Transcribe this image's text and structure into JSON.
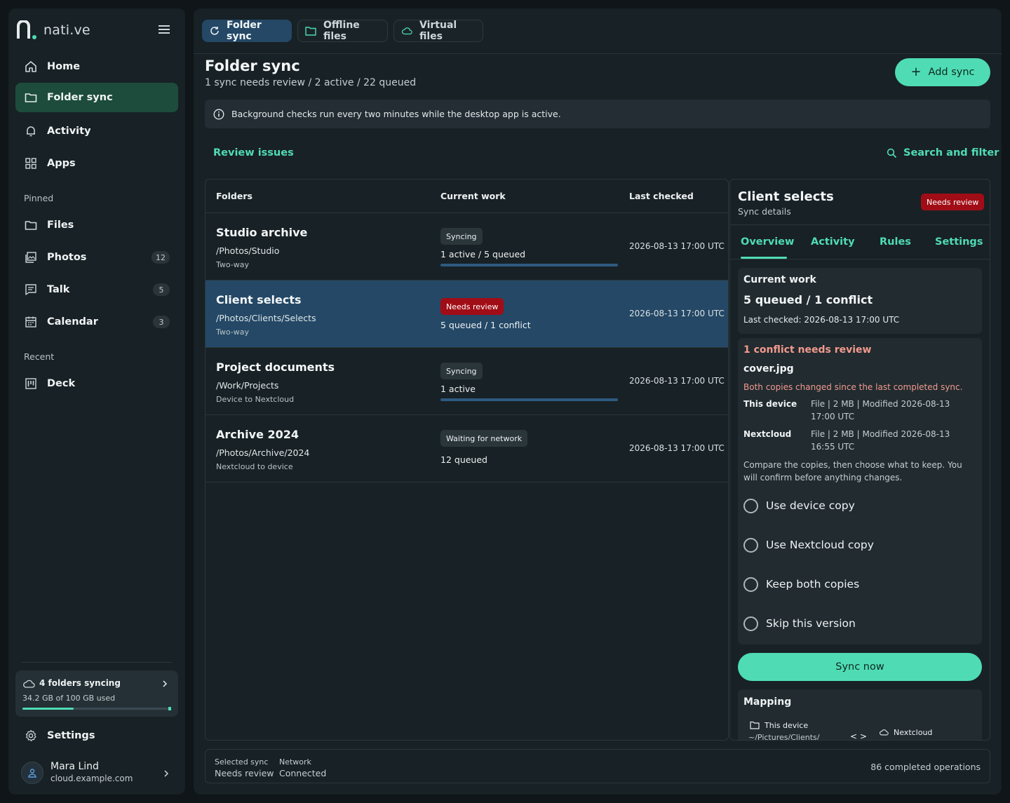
{
  "brand": {
    "name": "nati.ve"
  },
  "sidebar": {
    "nav": [
      {
        "label": "Home",
        "icon": "home-icon"
      },
      {
        "label": "Folder sync",
        "icon": "folder-icon",
        "active": true
      },
      {
        "label": "Activity",
        "icon": "bell-icon"
      },
      {
        "label": "Apps",
        "icon": "apps-grid-icon"
      }
    ],
    "pinned_label": "Pinned",
    "pinned": [
      {
        "label": "Files",
        "icon": "folder-icon"
      },
      {
        "label": "Photos",
        "icon": "photos-icon",
        "badge": "12"
      },
      {
        "label": "Talk",
        "icon": "chat-icon",
        "badge": "5"
      },
      {
        "label": "Calendar",
        "icon": "calendar-icon",
        "badge": "3"
      }
    ],
    "recent_label": "Recent",
    "recent": [
      {
        "label": "Deck",
        "icon": "deck-icon"
      }
    ],
    "storage": {
      "title": "4 folders syncing",
      "used": "34.2 GB of 100 GB used",
      "used_fraction": 0.342
    },
    "settings_label": "Settings",
    "user": {
      "name": "Mara Lind",
      "host": "cloud.example.com"
    }
  },
  "tabs": [
    {
      "label": "Folder sync",
      "icon": "refresh-icon",
      "active": true
    },
    {
      "label": "Offline files",
      "icon": "folder-icon"
    },
    {
      "label": "Virtual files",
      "icon": "cloud-icon"
    }
  ],
  "page": {
    "title": "Folder sync",
    "subtitle": "1 sync needs review / 2 active / 22 queued",
    "add_label": "Add sync",
    "info": "Background checks run every two minutes while the desktop app is active.",
    "review_link": "Review issues",
    "search_link": "Search and filter"
  },
  "table": {
    "headers": {
      "folders": "Folders",
      "work": "Current work",
      "checked": "Last checked"
    },
    "rows": [
      {
        "name": "Studio archive",
        "path": "/Photos/Studio",
        "mode": "Two-way",
        "status": "Syncing",
        "work": "1 active / 5 queued",
        "progress": 1.0,
        "checked": "2026-08-13 17:00 UTC"
      },
      {
        "name": "Client selects",
        "path": "/Photos/Clients/Selects",
        "mode": "Two-way",
        "status": "Needs review",
        "work": "5 queued / 1 conflict",
        "checked": "2026-08-13 17:00 UTC",
        "selected": true
      },
      {
        "name": "Project documents",
        "path": "/Work/Projects",
        "mode": "Device to Nextcloud",
        "status": "Syncing",
        "work": "1 active",
        "progress": 1.0,
        "checked": "2026-08-13 17:00 UTC"
      },
      {
        "name": "Archive 2024",
        "path": "/Photos/Archive/2024",
        "mode": "Nextcloud to device",
        "status": "Waiting for network",
        "work": "12 queued",
        "checked": "2026-08-13 17:00 UTC"
      }
    ]
  },
  "detail": {
    "title": "Client selects",
    "subtitle": "Sync details",
    "badge": "Needs review",
    "tabs": [
      "Overview",
      "Activity",
      "Rules",
      "Settings"
    ],
    "current_work": {
      "heading": "Current work",
      "value": "5 queued / 1 conflict",
      "checked": "Last checked: 2026-08-13 17:00 UTC"
    },
    "conflict": {
      "heading": "1 conflict needs review",
      "file": "cover.jpg",
      "desc": "Both copies changed since the last completed sync.",
      "device_label": "This device",
      "device_value": "File | 2 MB | Modified 2026-08-13 17:00 UTC",
      "cloud_label": "Nextcloud",
      "cloud_value": "File | 2 MB | Modified 2026-08-13 16:55 UTC",
      "help": "Compare the copies, then choose what to keep. You will confirm before anything changes.",
      "options": [
        "Use device copy",
        "Use Nextcloud copy",
        "Keep both copies",
        "Skip this version"
      ]
    },
    "sync_now": "Sync now",
    "mapping": {
      "heading": "Mapping",
      "device": "This device",
      "device_path": "~/Pictures/Clients/",
      "cloud": "Nextcloud",
      "arrow": "< >"
    }
  },
  "footer": {
    "selected_label": "Selected sync",
    "selected_value": "Needs review",
    "network_label": "Network",
    "network_value": "Connected",
    "completed": "86 completed operations"
  }
}
